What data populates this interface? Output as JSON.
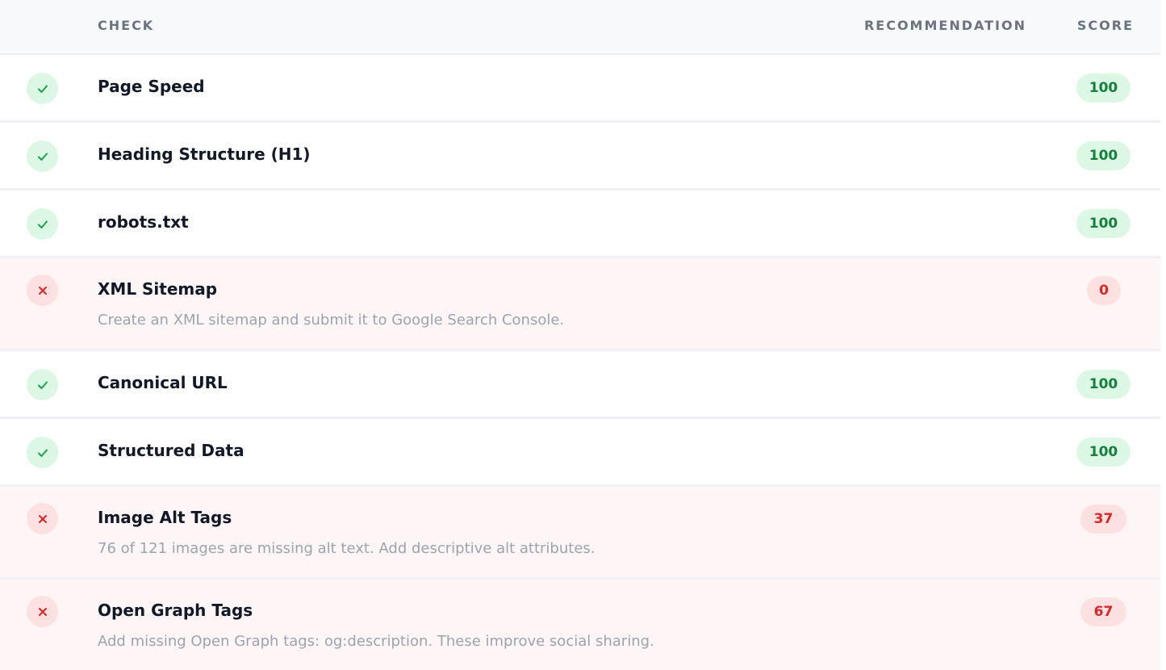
{
  "header": {
    "check": "CHECK",
    "recommendation": "RECOMMENDATION",
    "score": "SCORE"
  },
  "rows": [
    {
      "title": "Page Speed",
      "score": "100",
      "status": "pass",
      "icon": "check-icon"
    },
    {
      "title": "Heading Structure (H1)",
      "score": "100",
      "status": "pass",
      "icon": "check-icon"
    },
    {
      "title": "robots.txt",
      "score": "100",
      "status": "pass",
      "icon": "check-icon"
    },
    {
      "title": "XML Sitemap",
      "score": "0",
      "status": "fail",
      "icon": "x-icon",
      "recommendation": "Create an XML sitemap and submit it to Google Search Console."
    },
    {
      "title": "Canonical URL",
      "score": "100",
      "status": "pass",
      "icon": "check-icon"
    },
    {
      "title": "Structured Data",
      "score": "100",
      "status": "pass",
      "icon": "check-icon"
    },
    {
      "title": "Image Alt Tags",
      "score": "37",
      "status": "fail",
      "icon": "x-icon",
      "recommendation": "76 of 121 images are missing alt text. Add descriptive alt attributes."
    },
    {
      "title": "Open Graph Tags",
      "score": "67",
      "status": "fail",
      "icon": "x-icon",
      "recommendation": "Add missing Open Graph tags: og:description. These improve social sharing."
    }
  ],
  "colors": {
    "pass_bg": "#dcf7e3",
    "pass_fg": "#16a34a",
    "fail_bg": "#fde0e0",
    "fail_fg": "#dc2626",
    "fail_row_bg": "#fef6f6"
  }
}
